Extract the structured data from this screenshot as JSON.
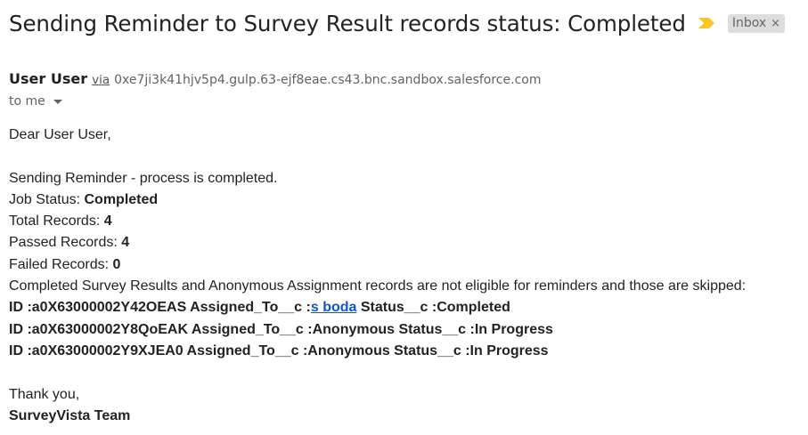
{
  "email": {
    "subject": "Sending Reminder to Survey Result records status: Completed",
    "label": "Inbox",
    "label_close": "×",
    "important_icon": "important-marker-icon",
    "sender_name": "User User",
    "via_label": "via",
    "sender_address": "0xe7ji3k41hjv5p4.gulp.63-ejf8eae.cs43.bnc.sandbox.salesforce.com",
    "recipient_label": "to me",
    "colors": {
      "important": "#f9c623",
      "link": "#1155cc",
      "chip_bg": "#dddddd"
    }
  },
  "body": {
    "greeting": "Dear User User,",
    "intro": "Sending Reminder - process is completed.",
    "job_status_label": "Job Status: ",
    "job_status_value": "Completed",
    "total_label": "Total Records: ",
    "total_value": "4",
    "passed_label": "Passed Records: ",
    "passed_value": "4",
    "failed_label": "Failed Records: ",
    "failed_value": "0",
    "note": "Completed Survey Results and Anonymous Assignment records are not eligible for reminders and those are skipped:",
    "records": [
      {
        "prefix": "ID :a0X63000002Y42OEAS Assigned_To__c :",
        "link": "s boda",
        "suffix": " Status__c :Completed"
      },
      {
        "text": "ID :a0X63000002Y8QoEAK Assigned_To__c :Anonymous Status__c :In Progress"
      },
      {
        "text": "ID :a0X63000002Y9XJEA0 Assigned_To__c :Anonymous Status__c :In Progress"
      }
    ],
    "thanks": "Thank you,",
    "signature": "SurveyVista Team"
  }
}
